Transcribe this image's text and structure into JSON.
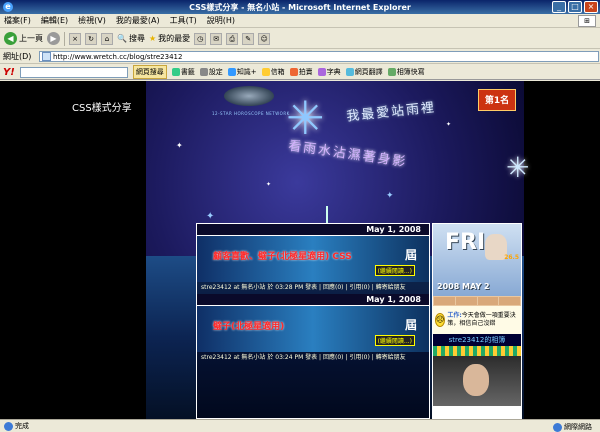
{
  "window": {
    "title": "CSS樣式分享 - 無名小站 - Microsoft Internet Explorer",
    "controls": [
      "_",
      "□",
      "×"
    ]
  },
  "menu": [
    "檔案(F)",
    "編輯(E)",
    "檢視(V)",
    "我的最愛(A)",
    "工具(T)",
    "說明(H)"
  ],
  "toolbar": {
    "back": "上一頁",
    "search": "搜尋",
    "favorites": "我的最愛"
  },
  "address": {
    "label": "網址(D)",
    "url": "http://www.wretch.cc/blog/stre23412"
  },
  "yahoo": {
    "logo": "Y!",
    "web_search": "網頁搜尋",
    "items": [
      "書籤",
      "設定",
      "知識+",
      "信箱",
      "拍賣",
      "字典",
      "網頁翻譯",
      "相簿快寫"
    ]
  },
  "page": {
    "site_name": "CSS樣式分享",
    "header_decor_1": "我最愛站雨裡",
    "header_decor_2": "看雨水沾濕著身影",
    "badge": "第1名",
    "logo_text": "12-STAR HOROSCOPE NETWORK",
    "posts": [
      {
        "date": "May 1, 2008",
        "title": "顧客喜歡、璧子(北極星適用) CSS",
        "continue": "(繼續閱讀...)",
        "meta": "stre23412 at 無名小站 於 03:28 PM 發表 | 回應(0) | 引用(0) | 轉寄給朋友"
      },
      {
        "date": "May 1, 2008",
        "title": "璧子(北極星適用)",
        "continue": "(繼續閱讀...)",
        "meta": "stre23412 at 無名小站 於 03:24 PM 發表 | 回應(0) | 引用(0) | 轉寄給朋友"
      }
    ],
    "sidebar": {
      "day": "FRI",
      "date": "2008 MAY 2",
      "temp": "26.5",
      "work_label": "工作:",
      "work_text": "今天會做一項重要決策，相信自己沒錯",
      "link_text": "stre23412的相簿"
    }
  },
  "status": {
    "text": "完成",
    "zone": "網際網路"
  }
}
